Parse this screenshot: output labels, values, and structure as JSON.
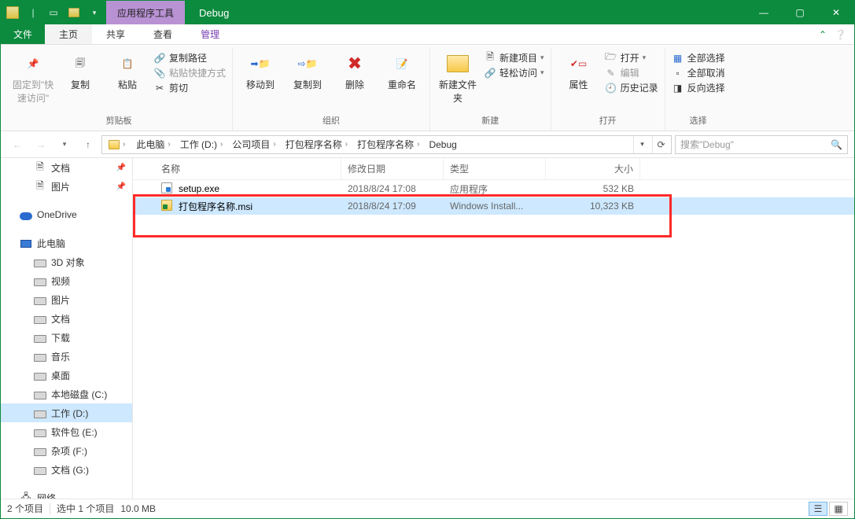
{
  "title": "Debug",
  "context_tab": "应用程序工具",
  "tabs": {
    "file": "文件",
    "home": "主页",
    "share": "共享",
    "view": "查看",
    "manage": "管理"
  },
  "ribbon": {
    "clipboard": {
      "pin": "固定到\"快速访问\"",
      "copy": "复制",
      "paste": "粘贴",
      "copypath": "复制路径",
      "pasteshortcut": "粘贴快捷方式",
      "cut": "剪切",
      "label": "剪贴板"
    },
    "organize": {
      "moveto": "移动到",
      "copyto": "复制到",
      "delete": "删除",
      "rename": "重命名",
      "label": "组织"
    },
    "new": {
      "newfolder": "新建文件夹",
      "newitem": "新建项目",
      "easyaccess": "轻松访问",
      "label": "新建"
    },
    "open": {
      "properties": "属性",
      "open": "打开",
      "edit": "编辑",
      "history": "历史记录",
      "label": "打开"
    },
    "select": {
      "selectall": "全部选择",
      "selectnone": "全部取消",
      "invert": "反向选择",
      "label": "选择"
    }
  },
  "breadcrumb": [
    "此电脑",
    "工作 (D:)",
    "公司项目",
    "打包程序名称",
    "打包程序名称",
    "Debug"
  ],
  "search_placeholder": "搜索\"Debug\"",
  "columns": {
    "name": "名称",
    "date": "修改日期",
    "type": "类型",
    "size": "大小"
  },
  "files": [
    {
      "name": "setup.exe",
      "date": "2018/8/24 17:08",
      "type": "应用程序",
      "size": "532 KB",
      "selected": false,
      "icon": "exe"
    },
    {
      "name": "打包程序名称.msi",
      "date": "2018/8/24 17:09",
      "type": "Windows Install...",
      "size": "10,323 KB",
      "selected": true,
      "icon": "msi"
    }
  ],
  "sidebar": {
    "quick": [
      {
        "label": "文档",
        "icon": "doc",
        "pinned": true
      },
      {
        "label": "图片",
        "icon": "pic",
        "pinned": true
      }
    ],
    "onedrive": "OneDrive",
    "pc": "此电脑",
    "pc_items": [
      {
        "label": "3D 对象"
      },
      {
        "label": "视频"
      },
      {
        "label": "图片"
      },
      {
        "label": "文档"
      },
      {
        "label": "下载"
      },
      {
        "label": "音乐"
      },
      {
        "label": "桌面"
      },
      {
        "label": "本地磁盘 (C:)"
      },
      {
        "label": "工作 (D:)",
        "active": true
      },
      {
        "label": "软件包 (E:)"
      },
      {
        "label": "杂项 (F:)"
      },
      {
        "label": "文档 (G:)"
      }
    ],
    "network": "网络"
  },
  "status": {
    "count": "2 个项目",
    "selected": "选中 1 个项目",
    "size": "10.0 MB"
  }
}
